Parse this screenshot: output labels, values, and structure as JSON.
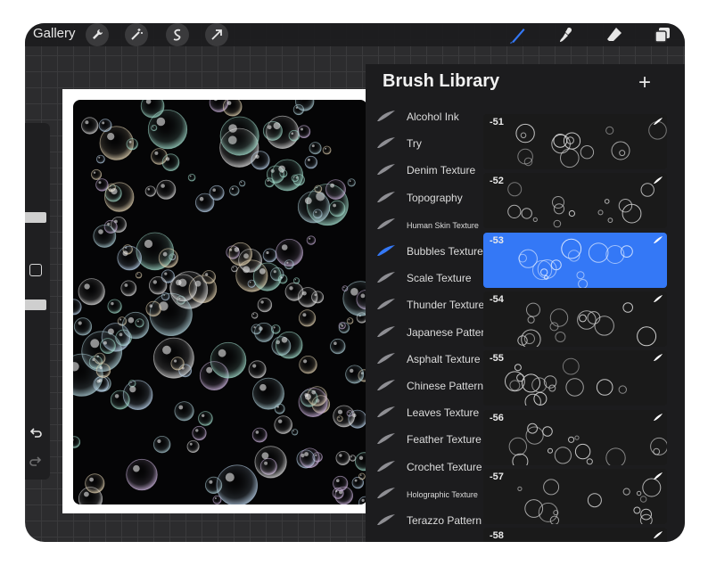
{
  "topbar": {
    "gallery_label": "Gallery",
    "left_tools": [
      "wrench-icon",
      "magic-wand-icon",
      "selection-icon",
      "transform-arrow-icon"
    ],
    "right_tools": [
      "brush-icon",
      "smudge-icon",
      "eraser-icon",
      "layers-icon"
    ]
  },
  "panel": {
    "title": "Brush Library",
    "add_label": "+",
    "sets": [
      {
        "label": "Alcohol Ink",
        "small": false
      },
      {
        "label": "Try",
        "small": false
      },
      {
        "label": "Denim Texture",
        "small": false
      },
      {
        "label": "Topography",
        "small": false
      },
      {
        "label": "Human Skin Texture",
        "small": true
      },
      {
        "label": "Bubbles Texture",
        "small": false,
        "selected": true
      },
      {
        "label": "Scale Texture",
        "small": false
      },
      {
        "label": "Thunder Texture",
        "small": false
      },
      {
        "label": "Japanese Pattern",
        "small": false
      },
      {
        "label": "Asphalt Texture",
        "small": false
      },
      {
        "label": "Chinese Pattern",
        "small": false
      },
      {
        "label": "Leaves Texture",
        "small": false
      },
      {
        "label": "Feather Texture",
        "small": false
      },
      {
        "label": "Crochet Texture",
        "small": false
      },
      {
        "label": "Holographic Texture",
        "small": true
      },
      {
        "label": "Terazzo Pattern",
        "small": false
      }
    ],
    "brushes": [
      {
        "label": "-51"
      },
      {
        "label": "-52"
      },
      {
        "label": "-53",
        "selected": true
      },
      {
        "label": "-54"
      },
      {
        "label": "-55"
      },
      {
        "label": "-56"
      },
      {
        "label": "-57"
      },
      {
        "label": "-58"
      }
    ]
  },
  "colors": {
    "accent": "#3478f6",
    "panel_bg": "#1c1c1e",
    "canvas_bg": "#050506"
  }
}
